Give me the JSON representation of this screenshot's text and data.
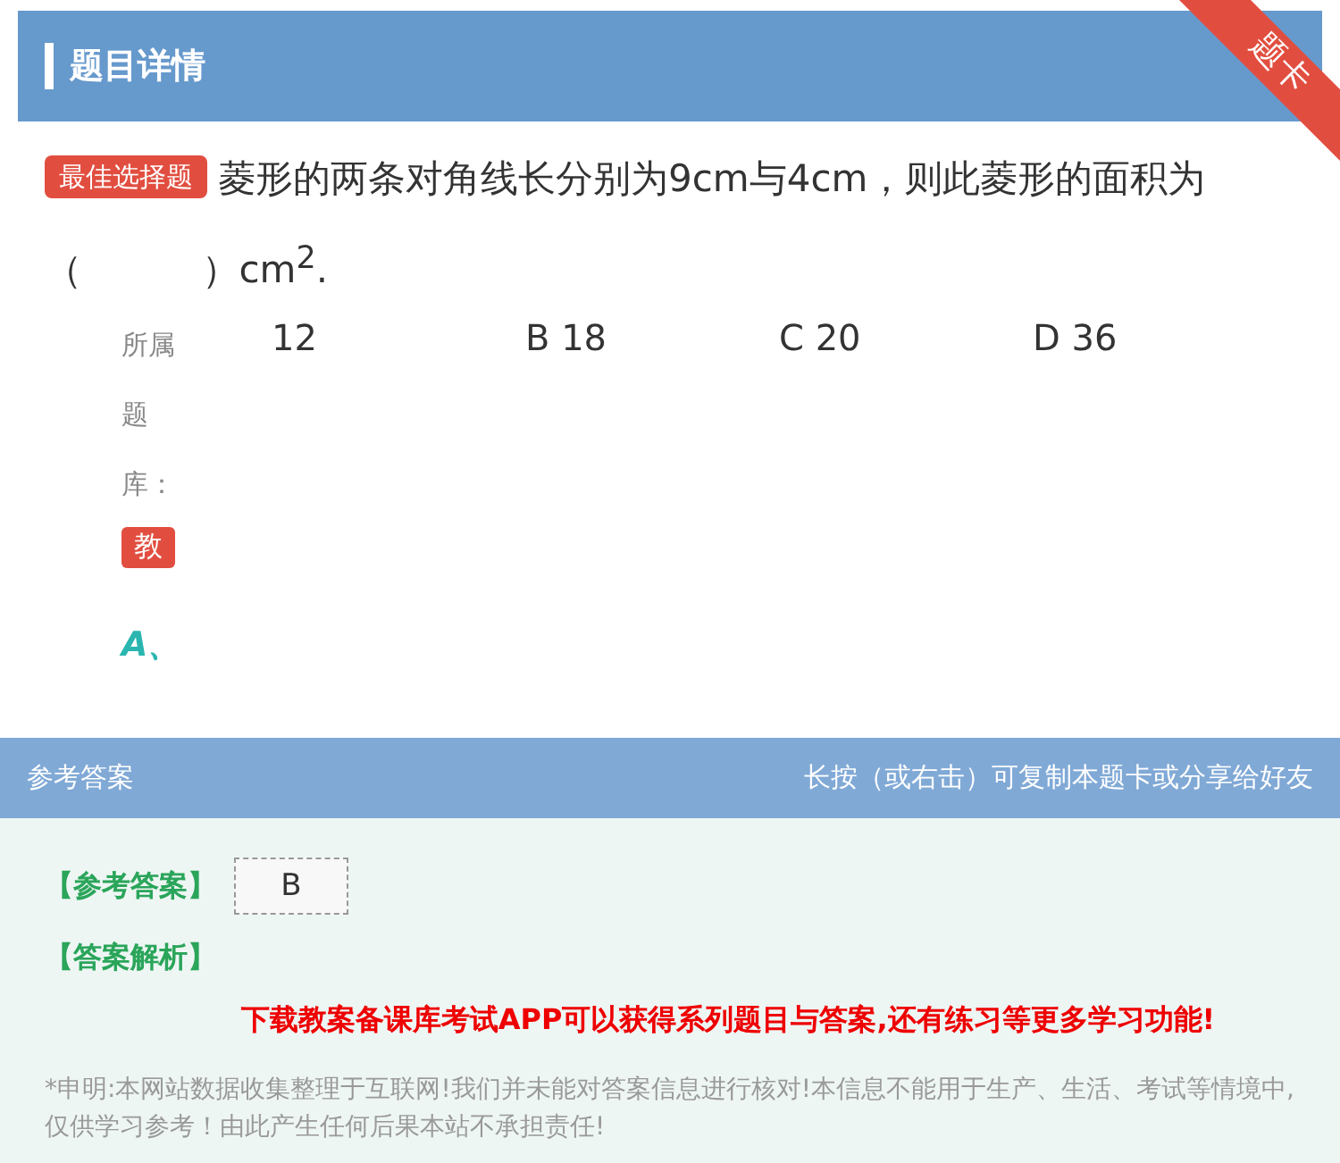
{
  "header": {
    "title": "题目详情",
    "ribbon": "题卡"
  },
  "question": {
    "tag": "最佳选择题",
    "text": "菱形的两条对角线长分别为9cm与4cm，则此菱形的面积为（          ）cm$^{2}$."
  },
  "options": [
    "12",
    "B 18",
    "C 20",
    "D 36"
  ],
  "bank": {
    "label": "所属题库：",
    "badge": "教"
  },
  "answer_mark": "A、",
  "answer_bar": {
    "title": "参考答案",
    "hint": "长按（或右击）可复制本题卡或分享给好友"
  },
  "answer": {
    "label": "【参考答案】",
    "value": "B",
    "analysis_label": "【答案解析】"
  },
  "promo": "下载教案备课库考试APP可以获得系列题目与答案,还有练习等更多学习功能!",
  "disclaimer": "*申明:本网站数据收集整理于互联网!我们并未能对答案信息进行核对!本信息不能用于生产、生活、考试等情境中,仅供学习参考！由此产生任何后果本站不承担责任!"
}
